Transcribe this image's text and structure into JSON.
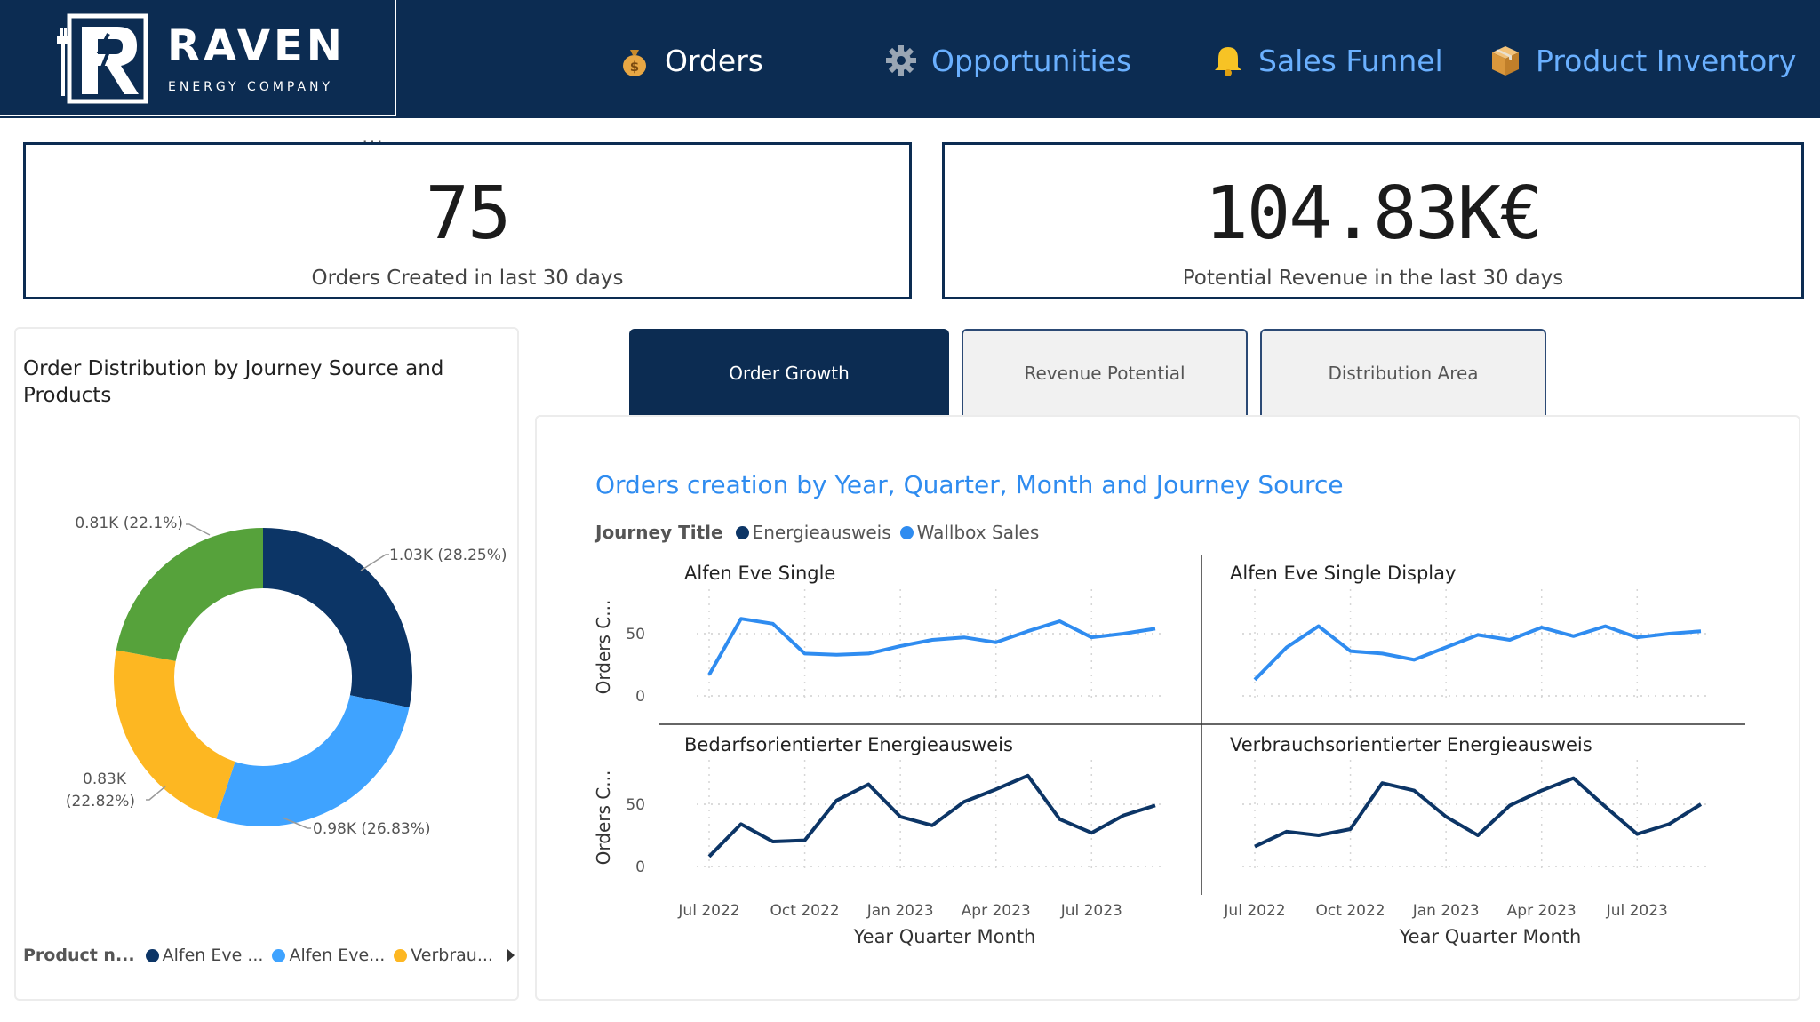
{
  "brand": {
    "name": "RAVEN",
    "tagline": "ENERGY COMPANY"
  },
  "nav": {
    "items": [
      {
        "label": "Orders",
        "icon": "money-bag-icon"
      },
      {
        "label": "Opportunities",
        "icon": "gear-icon"
      },
      {
        "label": "Sales Funnel",
        "icon": "bell-icon"
      },
      {
        "label": "Product Inventory",
        "icon": "package-icon"
      }
    ]
  },
  "kpis": {
    "orders": {
      "value": "75",
      "label": "Orders Created in last 30 days"
    },
    "revenue": {
      "value": "104.83K€",
      "label": "Potential Revenue in the last 30 days"
    },
    "more_options": "..."
  },
  "donut": {
    "title": "Order Distribution by Journey Source and Products",
    "legend_title": "Product n...",
    "legend_items": [
      {
        "label": "Alfen Eve ...",
        "color": "#0c3566"
      },
      {
        "label": "Alfen Eve...",
        "color": "#3fa3ff"
      },
      {
        "label": "Verbrau...",
        "color": "#fdb722"
      }
    ]
  },
  "tabs": {
    "order_growth": "Order Growth",
    "revenue_potential": "Revenue Potential",
    "distribution_area": "Distribution Area"
  },
  "line_chart": {
    "title": "Orders creation by Year, Quarter, Month and Journey Source",
    "legend_title": "Journey Title",
    "legend_items": [
      {
        "label": "Energieausweis",
        "color": "#0c3566"
      },
      {
        "label": "Wallbox Sales",
        "color": "#2f8cf0"
      }
    ]
  },
  "chart_data": [
    {
      "type": "pie",
      "title": "Order Distribution by Journey Source and Products",
      "slices": [
        {
          "label": "1.03K (28.25%)",
          "value": 1030,
          "percent": 28.25,
          "color": "#0c3566"
        },
        {
          "label": "0.98K (26.83%)",
          "value": 980,
          "percent": 26.83,
          "color": "#3fa3ff"
        },
        {
          "label": "0.83K (22.82%)",
          "value": 830,
          "percent": 22.82,
          "color": "#fdb722"
        },
        {
          "label": "0.81K (22.1%)",
          "value": 810,
          "percent": 22.1,
          "color": "#56a23b"
        }
      ]
    },
    {
      "type": "line",
      "title": "Orders creation by Year, Quarter, Month and Journey Source",
      "xlabel": "Year Quarter Month",
      "ylabel": "Orders C...",
      "x_ticks": [
        "Jul 2022",
        "Oct 2022",
        "Jan 2023",
        "Apr 2023",
        "Jul 2023"
      ],
      "y_ticks": [
        "0",
        "50"
      ],
      "ylim": [
        0,
        80
      ],
      "months": 15,
      "panels": [
        {
          "title": "Alfen Eve Single",
          "series": "Wallbox Sales",
          "color": "#2f8cf0",
          "values": [
            17,
            62,
            58,
            34,
            33,
            34,
            40,
            45,
            47,
            43,
            52,
            60,
            47,
            50,
            54
          ]
        },
        {
          "title": "Alfen Eve Single Display",
          "series": "Wallbox Sales",
          "color": "#2f8cf0",
          "values": [
            13,
            39,
            56,
            36,
            34,
            29,
            39,
            49,
            45,
            55,
            48,
            56,
            47,
            50,
            52
          ]
        },
        {
          "title": "Bedarfsorientierter Energieausweis",
          "series": "Energieausweis",
          "color": "#0c3566",
          "values": [
            8,
            34,
            20,
            21,
            53,
            66,
            40,
            33,
            52,
            62,
            73,
            38,
            27,
            41,
            49
          ]
        },
        {
          "title": "Verbrauchsorientierter Energieausweis",
          "series": "Energieausweis",
          "color": "#0c3566",
          "values": [
            16,
            28,
            25,
            30,
            67,
            61,
            40,
            25,
            49,
            61,
            71,
            48,
            26,
            34,
            50
          ]
        }
      ]
    }
  ]
}
